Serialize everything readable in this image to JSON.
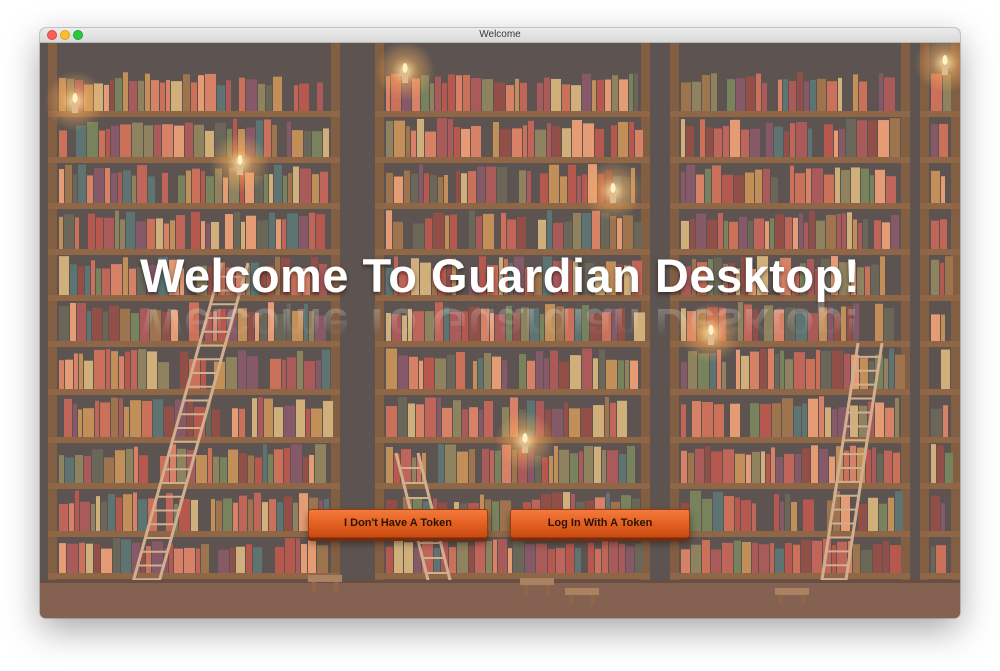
{
  "window": {
    "title": "Welcome"
  },
  "welcome": {
    "headline": "Welcome To Guardian Desktop!"
  },
  "actions": {
    "no_token_label": "I Don't Have A Token",
    "login_label": "Log In With A Token"
  },
  "colors": {
    "button": "#e25e1e",
    "shelf_wood": "#7a4a24",
    "floor": "#6e4332"
  }
}
